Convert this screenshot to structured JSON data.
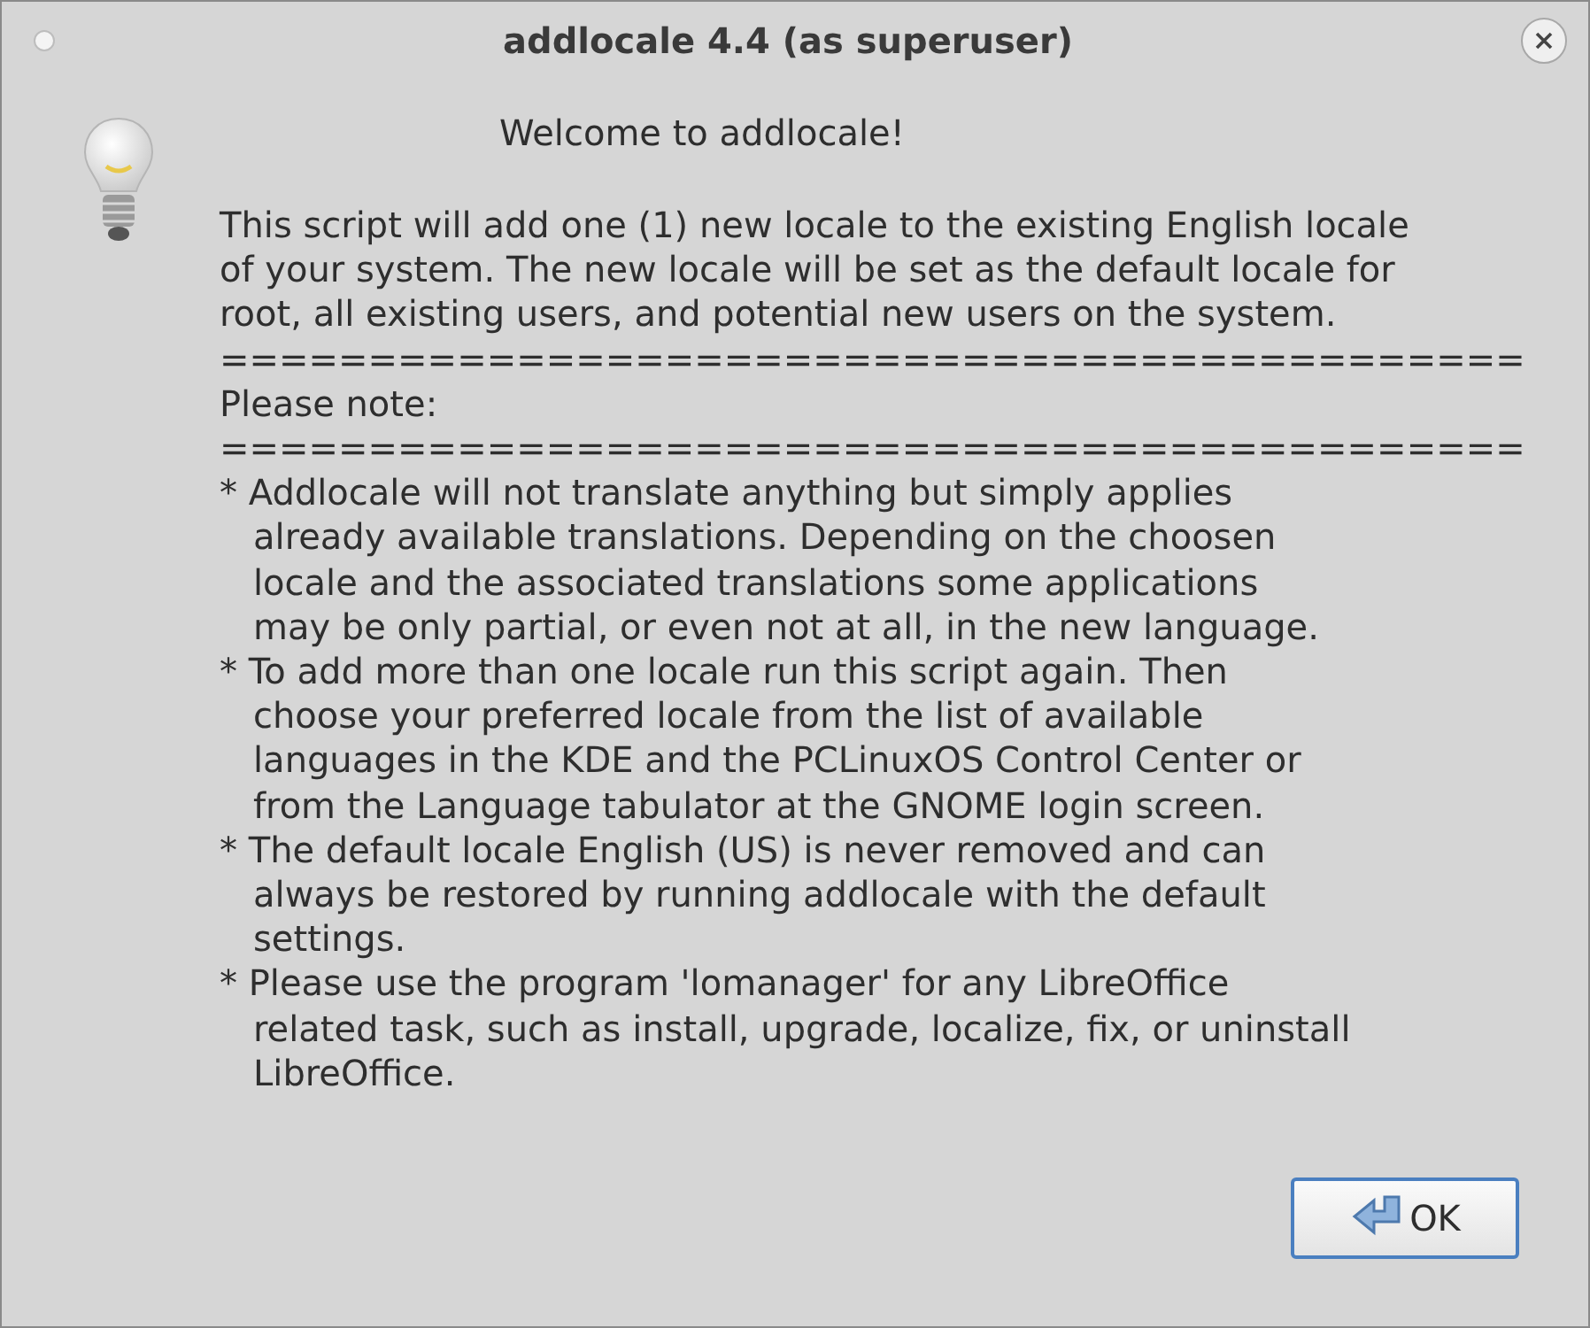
{
  "window": {
    "title": "addlocale 4.4 (as superuser)"
  },
  "heading": "Welcome to addlocale!",
  "lines": [
    {
      "kind": "plain",
      "text": "This script will add one (1) new locale to the existing English locale"
    },
    {
      "kind": "plain",
      "text": "of your system. The new locale will be set as the default locale for"
    },
    {
      "kind": "plain",
      "text": "root, all existing users, and potential new users on the system."
    },
    {
      "kind": "plain",
      "text": "============================================"
    },
    {
      "kind": "plain",
      "text": "Please note:"
    },
    {
      "kind": "plain",
      "text": "============================================"
    },
    {
      "kind": "plain",
      "text": "* Addlocale will not translate anything but simply applies"
    },
    {
      "kind": "continuation",
      "text": "already available translations. Depending on the choosen"
    },
    {
      "kind": "continuation",
      "text": "locale and the associated translations some applications"
    },
    {
      "kind": "continuation",
      "text": "may be only partial, or even not at all, in the new language."
    },
    {
      "kind": "plain",
      "text": "* To add more than one locale run this script again. Then"
    },
    {
      "kind": "continuation",
      "text": "choose your preferred locale from the list of available"
    },
    {
      "kind": "continuation",
      "text": "languages in the KDE and the PCLinuxOS Control Center or"
    },
    {
      "kind": "continuation",
      "text": "from the Language tabulator at the GNOME login screen."
    },
    {
      "kind": "plain",
      "text": "* The default locale English (US) is never removed and can"
    },
    {
      "kind": "continuation",
      "text": "always be restored by running addlocale with the default"
    },
    {
      "kind": "continuation",
      "text": "settings."
    },
    {
      "kind": "plain",
      "text": "* Please use the program 'lomanager' for any LibreOffice"
    },
    {
      "kind": "continuation",
      "text": "related task, such as install, upgrade, localize, fix, or uninstall"
    },
    {
      "kind": "continuation",
      "text": "LibreOffice."
    }
  ],
  "buttons": [
    {
      "label": "OK"
    }
  ]
}
